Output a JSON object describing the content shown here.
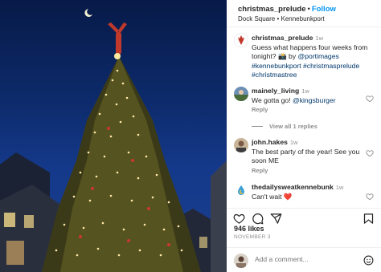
{
  "header": {
    "username": "christmas_prelude",
    "follow_label": "Follow",
    "location": "Dock Square • Kennebunkport"
  },
  "caption": {
    "username": "christmas_prelude",
    "time": "1w",
    "text_before": "Guess what happens four weeks from tonight? 📸 by ",
    "mention": "@portimages",
    "hashtags": "#kennebunkport #christmasprelude #christmastree"
  },
  "comments": [
    {
      "username": "mainely_living",
      "time": "1w",
      "text": "We gotta go! ",
      "mention": "@kingsburger",
      "reply_label": "Reply",
      "view_replies": "View all 1 replies"
    },
    {
      "username": "john.hakes",
      "time": "1w",
      "text": "The best party of the year! See you soon ME",
      "reply_label": "Reply"
    },
    {
      "username": "thedailysweatkennebunk",
      "time": "1w",
      "text": "Can't wait ❤️"
    }
  ],
  "likes": "946 likes",
  "date": "NOVEMBER 3",
  "add_comment_placeholder": "Add a comment...",
  "icons": [
    "heart-icon",
    "comment-icon",
    "share-icon",
    "bookmark-icon",
    "emoji-icon"
  ],
  "colors": {
    "link": "#0095f6",
    "mention": "#00376b",
    "muted": "#8e8e8e",
    "heart_red": "#ed4956"
  }
}
